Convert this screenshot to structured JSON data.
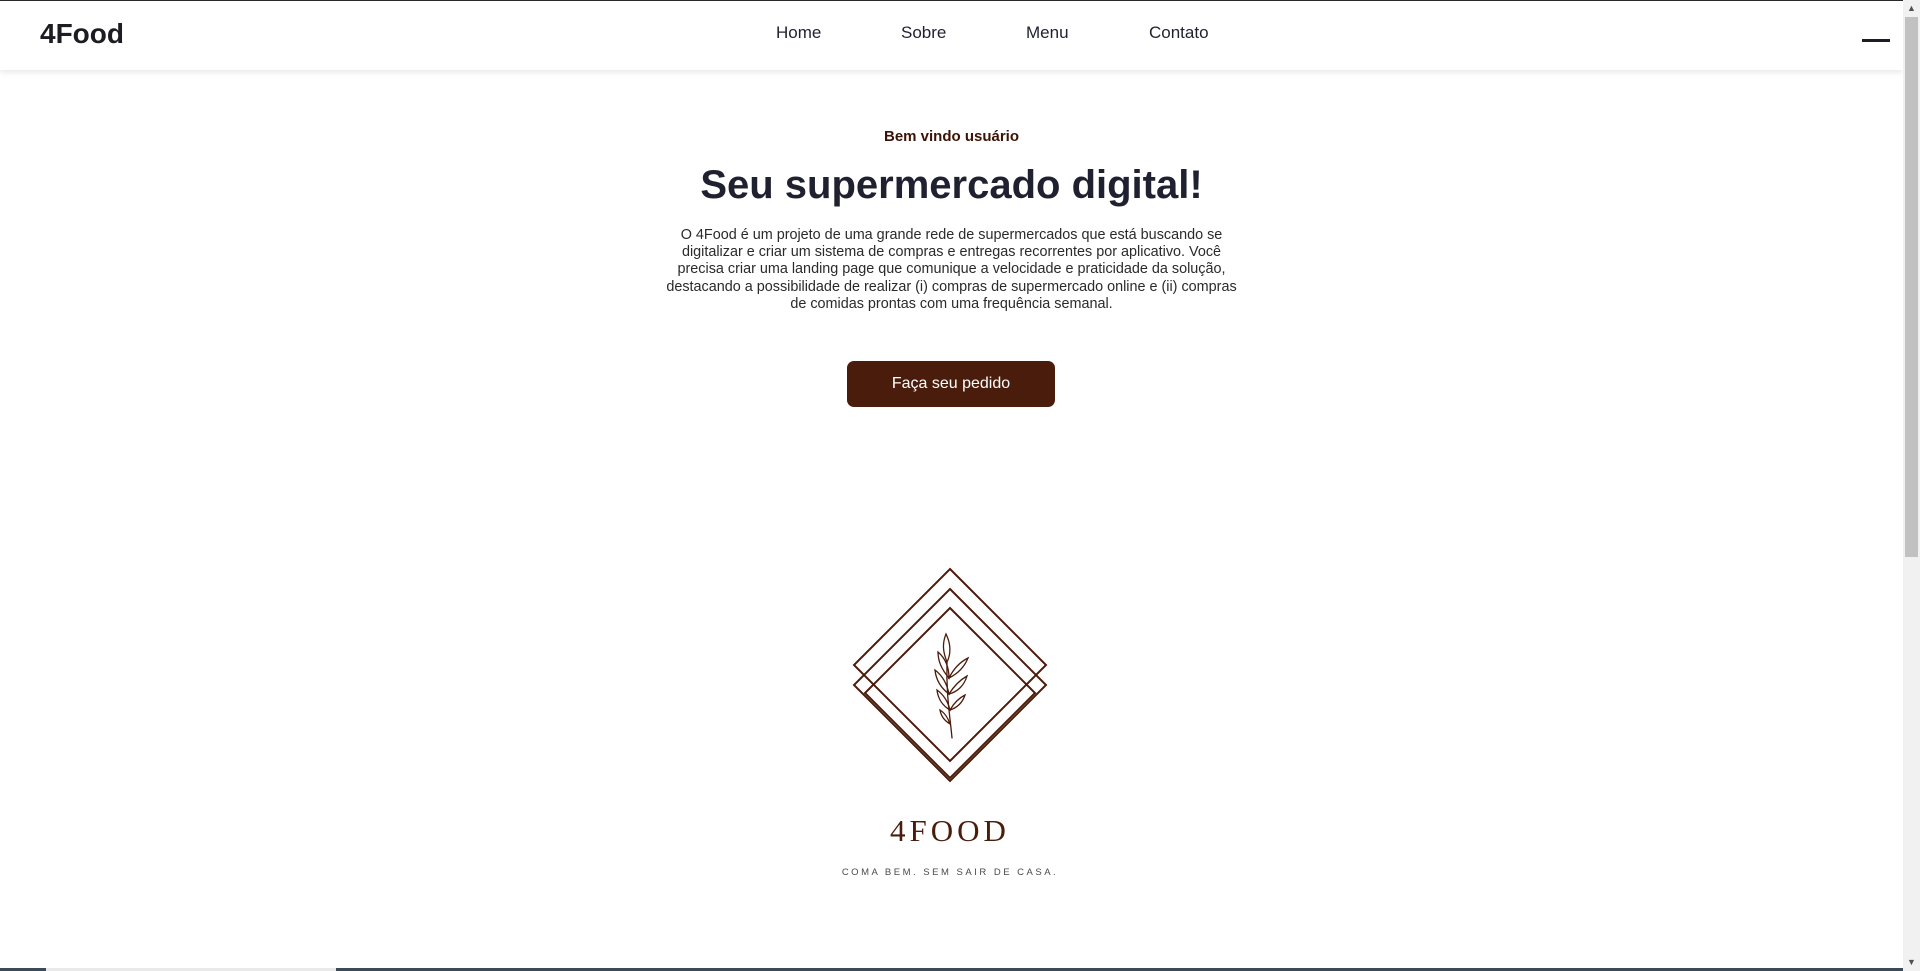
{
  "header": {
    "brand": "4Food",
    "nav": [
      {
        "label": "Home"
      },
      {
        "label": "Sobre"
      },
      {
        "label": "Menu"
      },
      {
        "label": "Contato"
      }
    ],
    "menu_icon": "hamburger-icon"
  },
  "hero": {
    "welcome": "Bem vindo usuário",
    "title": "Seu supermercado digital!",
    "description": "O 4Food é um projeto de uma grande rede de supermercados que está buscando se digitalizar e criar um sistema de compras e entregas recorrentes por aplicativo. Você precisa criar uma landing page que comunique a velocidade e praticidade da solução, destacando a possibilidade de realizar (i) compras de supermercado online e (ii) compras de comidas prontas com uma frequência semanal.",
    "cta_label": "Faça seu pedido"
  },
  "logo": {
    "name": "4FOOD",
    "tagline": "COMA BEM. SEM SAIR DE CASA.",
    "icon": "wheat-diamond-logo"
  },
  "colors": {
    "accent": "#4a1c0b",
    "text": "#1f2130",
    "background": "#ffffff"
  }
}
